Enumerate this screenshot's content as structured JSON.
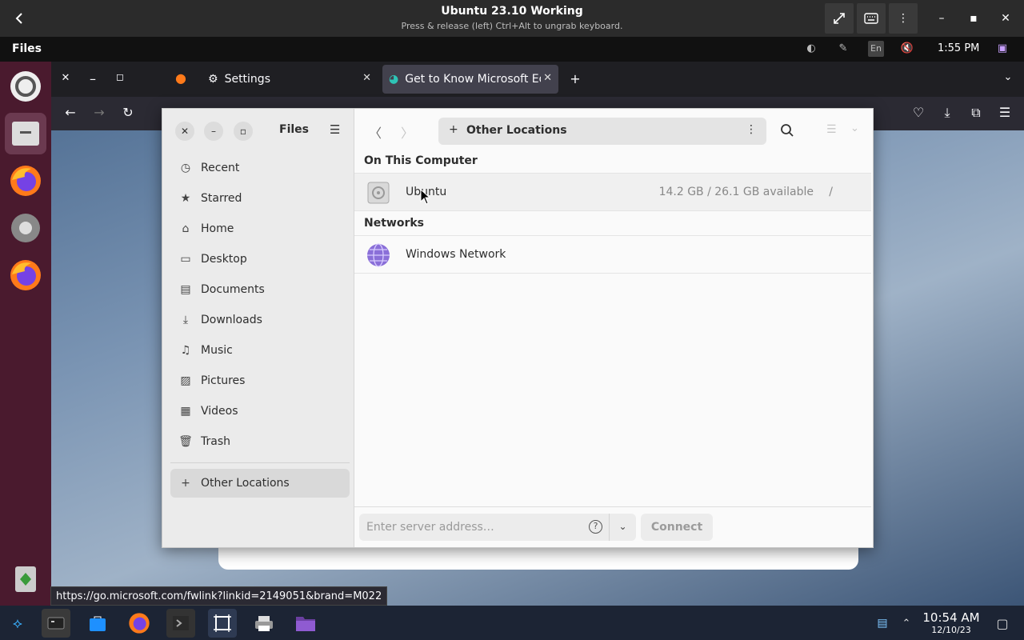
{
  "viewer": {
    "title": "Ubuntu 23.10 Working",
    "subtitle": "Press & release (left) Ctrl+Alt to ungrab keyboard."
  },
  "gnome": {
    "activities": "Files",
    "keyboard_layout": "En",
    "clock": "1:55 PM"
  },
  "browser": {
    "tabs": [
      {
        "label": "Settings",
        "icon": "gear-icon"
      },
      {
        "label": "Get to Know Microsoft Ed",
        "icon": "edge-icon",
        "active": true
      }
    ],
    "status_url": "https://go.microsoft.com/fwlink?linkid=2149051&brand=M022"
  },
  "files": {
    "title": "Files",
    "location": "Other Locations",
    "sidebar": [
      {
        "label": "Recent",
        "icon": "clock-icon"
      },
      {
        "label": "Starred",
        "icon": "star-icon"
      },
      {
        "label": "Home",
        "icon": "home-icon"
      },
      {
        "label": "Desktop",
        "icon": "desktop-icon"
      },
      {
        "label": "Documents",
        "icon": "document-icon"
      },
      {
        "label": "Downloads",
        "icon": "download-icon"
      },
      {
        "label": "Music",
        "icon": "music-icon"
      },
      {
        "label": "Pictures",
        "icon": "picture-icon"
      },
      {
        "label": "Videos",
        "icon": "video-icon"
      },
      {
        "label": "Trash",
        "icon": "trash-icon"
      }
    ],
    "other_locations_label": "Other Locations",
    "section_computer": "On This Computer",
    "section_networks": "Networks",
    "computer_rows": [
      {
        "name": "Ubuntu",
        "info": "14.2 GB / 26.1 GB available",
        "mount": "/"
      }
    ],
    "network_rows": [
      {
        "name": "Windows Network"
      }
    ],
    "server_placeholder": "Enter server address…",
    "help_label": "?",
    "connect_label": "Connect"
  },
  "taskbar": {
    "time": "10:54 AM",
    "date": "12/10/23"
  }
}
